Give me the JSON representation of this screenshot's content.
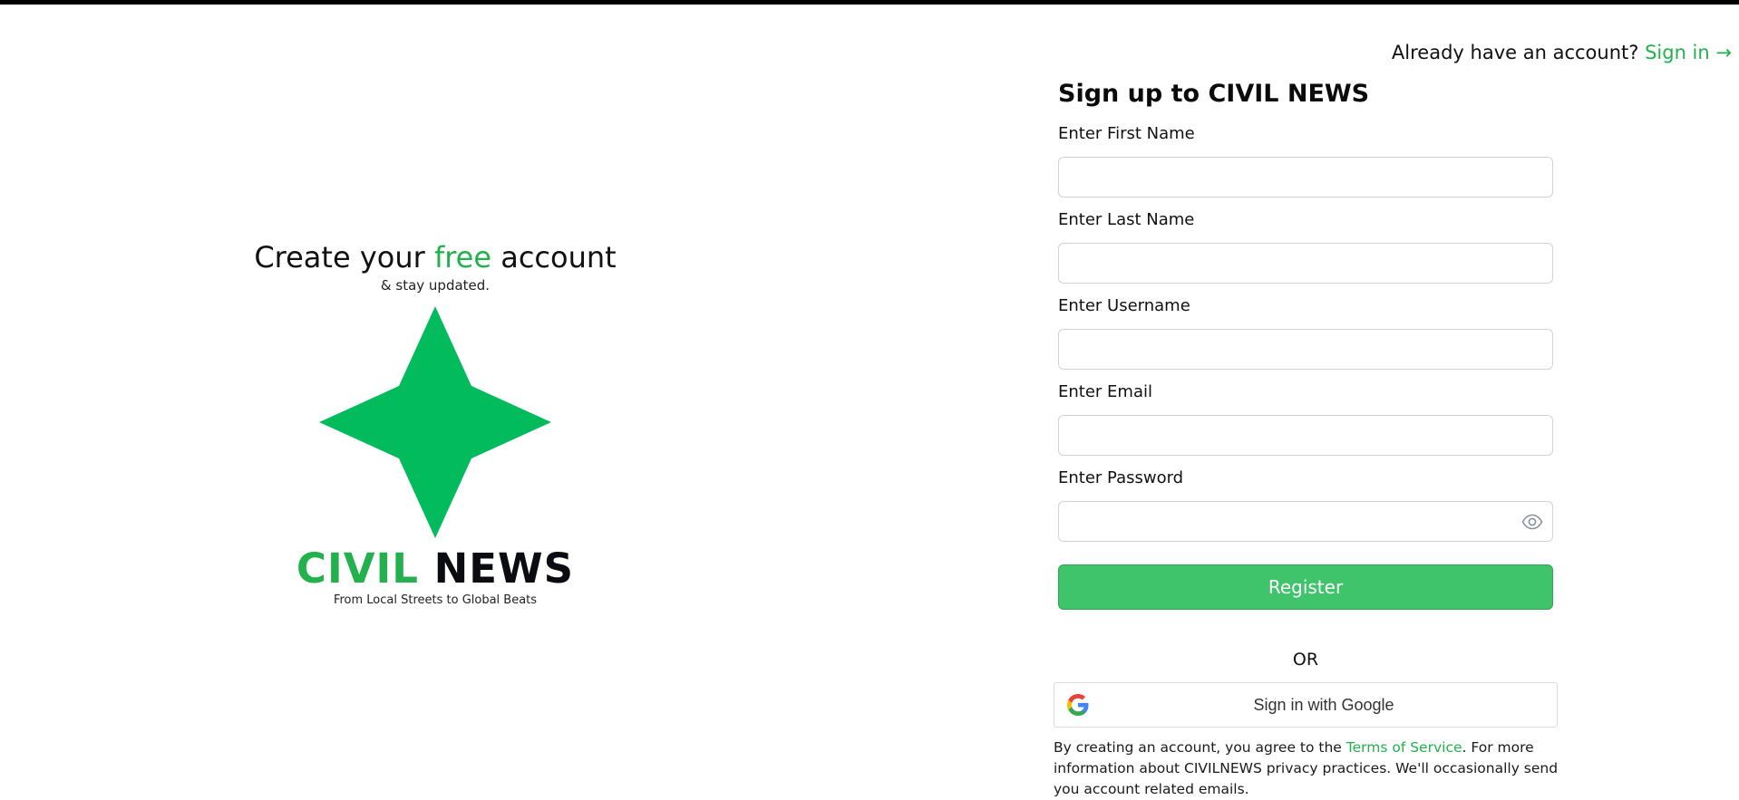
{
  "hero": {
    "title_prefix": "Create your",
    "title_accent": "free",
    "title_suffix": "account",
    "subtitle": "& stay updated.",
    "brand_part1": "CIVIL",
    "brand_part2": "NEWS",
    "tagline": "From Local Streets to Global Beats",
    "logo_icon": "four-point-star-icon",
    "accent_color": "#22b14c"
  },
  "header": {
    "prompt": "Already have an account?",
    "signin_label": "Sign in",
    "signin_arrow": "→"
  },
  "form": {
    "title": "Sign up to CIVIL NEWS",
    "fields": [
      {
        "label": "Enter First Name",
        "value": "",
        "placeholder": ""
      },
      {
        "label": "Enter Last Name",
        "value": "",
        "placeholder": ""
      },
      {
        "label": "Enter Username",
        "value": "",
        "placeholder": ""
      },
      {
        "label": "Enter Email",
        "value": "",
        "placeholder": ""
      },
      {
        "label": "Enter Password",
        "value": "",
        "placeholder": ""
      }
    ],
    "password_toggle_icon": "eye-icon",
    "register_label": "Register",
    "register_color": "#3fc36b",
    "or_label": "OR",
    "google_label": "Sign in with Google",
    "google_icon": "google-icon"
  },
  "legal": {
    "before_link": "By creating an account, you agree to the ",
    "link_text": "Terms of Service",
    "after_link": ". For more information about CIVILNEWS privacy practices. We'll occasionally send you account  related emails."
  }
}
